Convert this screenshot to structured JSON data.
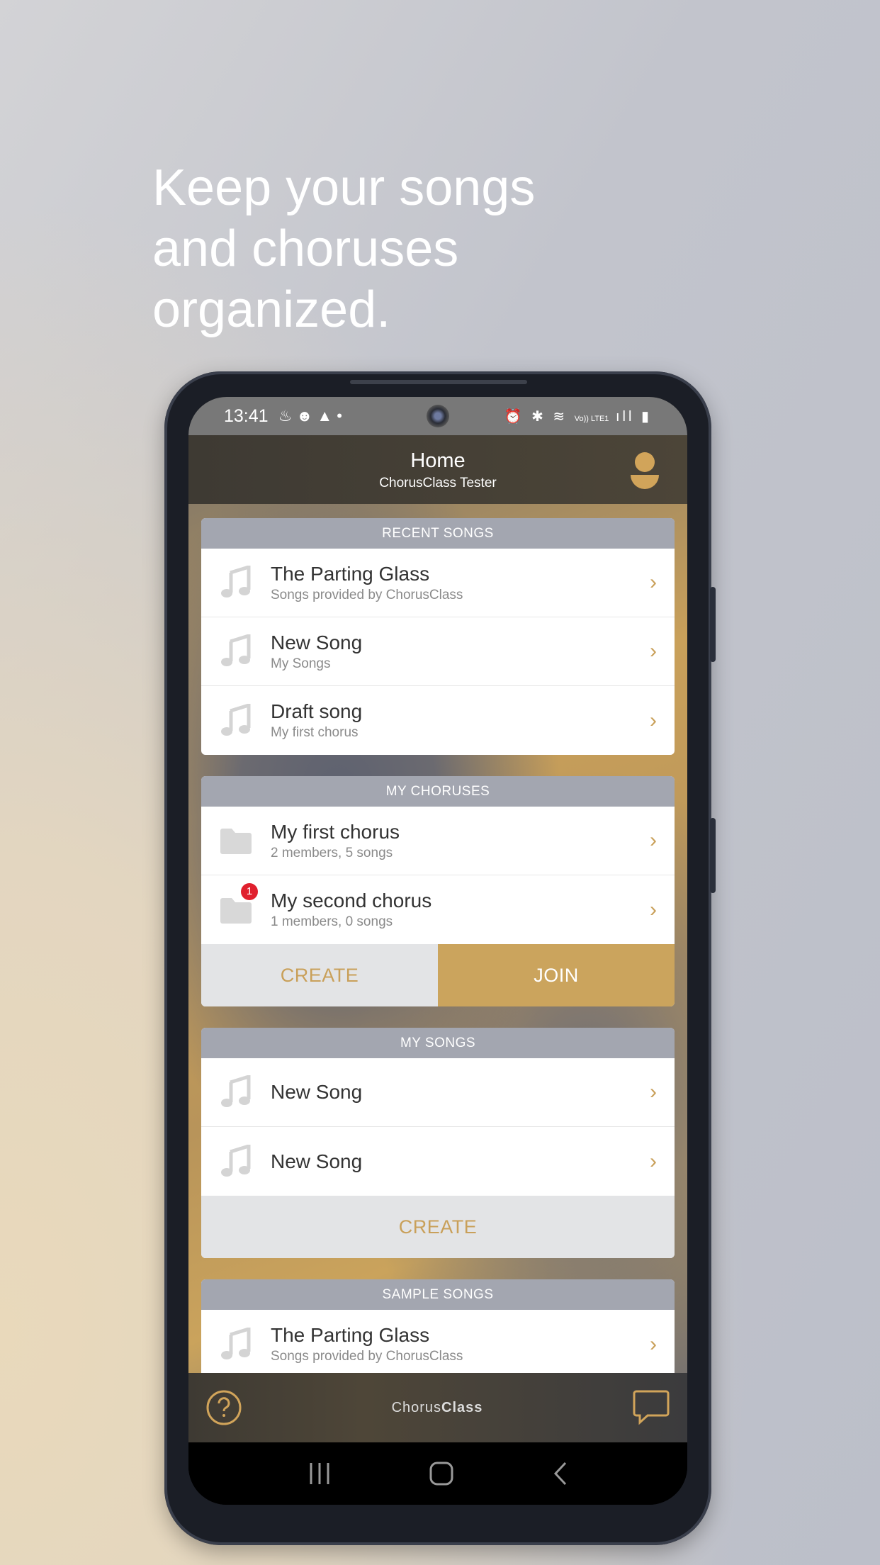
{
  "headline": [
    "Keep your songs",
    "and choruses",
    "organized."
  ],
  "status_bar": {
    "time": "13:41",
    "left_icons": [
      "notification-icon",
      "face-icon",
      "navigation-icon",
      "dot-icon"
    ],
    "right_icons": [
      "alarm-icon",
      "bluetooth-icon",
      "wifi-icon",
      "volte-icon",
      "signal-icon",
      "battery-icon"
    ],
    "network_label": "Vo)) LTE1"
  },
  "header": {
    "title": "Home",
    "subtitle": "ChorusClass Tester",
    "profile_icon": "user-icon"
  },
  "recent_songs": {
    "title": "RECENT SONGS",
    "items": [
      {
        "title": "The Parting Glass",
        "subtitle": "Songs provided by ChorusClass"
      },
      {
        "title": "New Song",
        "subtitle": "My Songs"
      },
      {
        "title": "Draft song",
        "subtitle": "My first chorus"
      }
    ]
  },
  "my_choruses": {
    "title": "MY CHORUSES",
    "items": [
      {
        "title": "My first chorus",
        "subtitle": "2 members, 5 songs",
        "badge": ""
      },
      {
        "title": "My second chorus",
        "subtitle": "1 members, 0 songs",
        "badge": "1"
      }
    ],
    "create_label": "CREATE",
    "join_label": "JOIN"
  },
  "my_songs": {
    "title": "MY SONGS",
    "items": [
      {
        "title": "New Song"
      },
      {
        "title": "New Song"
      }
    ],
    "create_label": "CREATE"
  },
  "sample_songs": {
    "title": "SAMPLE SONGS",
    "items": [
      {
        "title": "The Parting Glass",
        "subtitle": "Songs provided by ChorusClass"
      }
    ]
  },
  "footer": {
    "brand_light": "Chorus",
    "brand_bold": "Class",
    "help_icon": "help-icon",
    "chat_icon": "chat-icon"
  },
  "colors": {
    "accent": "#cba45d",
    "section_header": "#a3a6b0",
    "badge": "#e0202e"
  }
}
